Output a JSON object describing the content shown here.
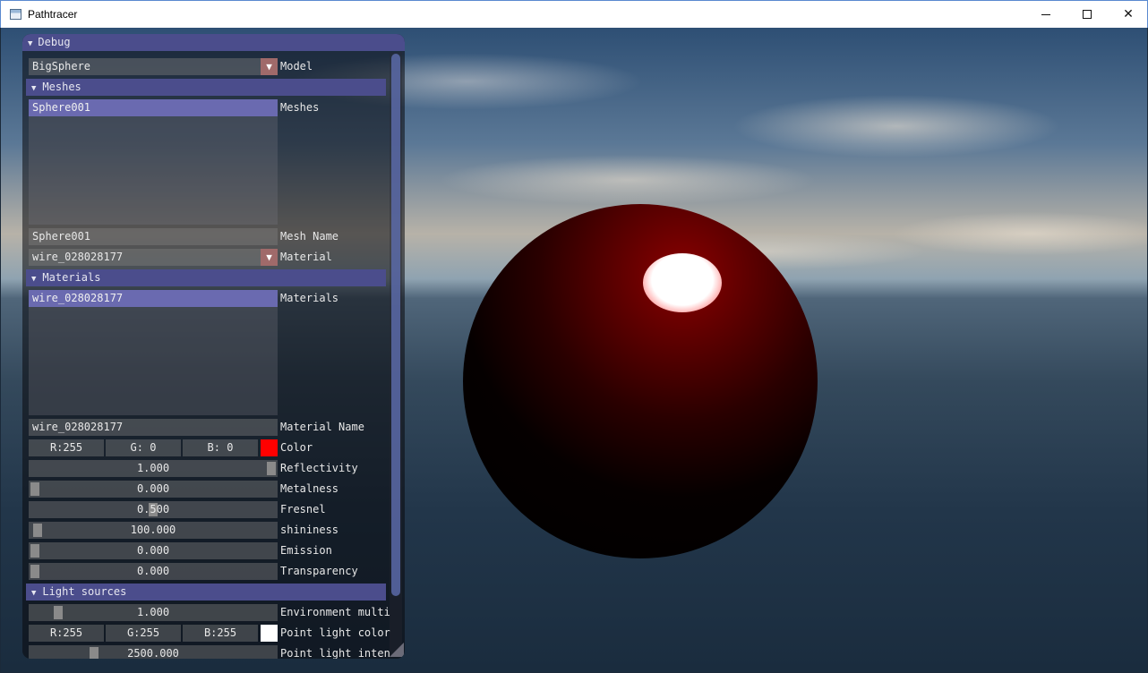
{
  "window": {
    "title": "Pathtracer",
    "minimize": "",
    "maximize": "",
    "close": "✕"
  },
  "panel": {
    "title": "Debug",
    "model": {
      "value": "BigSphere",
      "label": "Model"
    },
    "meshes_header": "Meshes",
    "meshes": {
      "items": [
        "Sphere001"
      ],
      "label": "Meshes"
    },
    "mesh_name": {
      "value": "Sphere001",
      "label": "Mesh Name"
    },
    "material_select": {
      "value": "wire_028028177",
      "label": "Material"
    },
    "materials_header": "Materials",
    "materials": {
      "items": [
        "wire_028028177"
      ],
      "label": "Materials"
    },
    "material_name": {
      "value": "wire_028028177",
      "label": "Material Name"
    },
    "color": {
      "r": "R:255",
      "g": "G:  0",
      "b": "B:  0",
      "swatch": "#ff0000",
      "label": "Color"
    },
    "reflectivity": {
      "value": "1.000",
      "fraction": 1.0,
      "label": "Reflectivity"
    },
    "metalness": {
      "value": "0.000",
      "fraction": 0.0,
      "label": "Metalness"
    },
    "fresnel": {
      "value": "0.500",
      "fraction": 0.5,
      "label": "Fresnel"
    },
    "shininess": {
      "value": "100.000",
      "fraction": 0.01,
      "label": "shininess"
    },
    "emission": {
      "value": "0.000",
      "fraction": 0.0,
      "label": "Emission"
    },
    "transparency": {
      "value": "0.000",
      "fraction": 0.0,
      "label": "Transparency"
    },
    "light_header": "Light sources",
    "env_multiplier": {
      "value": "1.000",
      "fraction": 0.1,
      "label": "Environment multi"
    },
    "point_light_color": {
      "r": "R:255",
      "g": "G:255",
      "b": "B:255",
      "swatch": "#ffffff",
      "label": "Point light color"
    },
    "point_light_intensity": {
      "value": "2500.000",
      "fraction": 0.25,
      "label": "Point light inten"
    }
  }
}
